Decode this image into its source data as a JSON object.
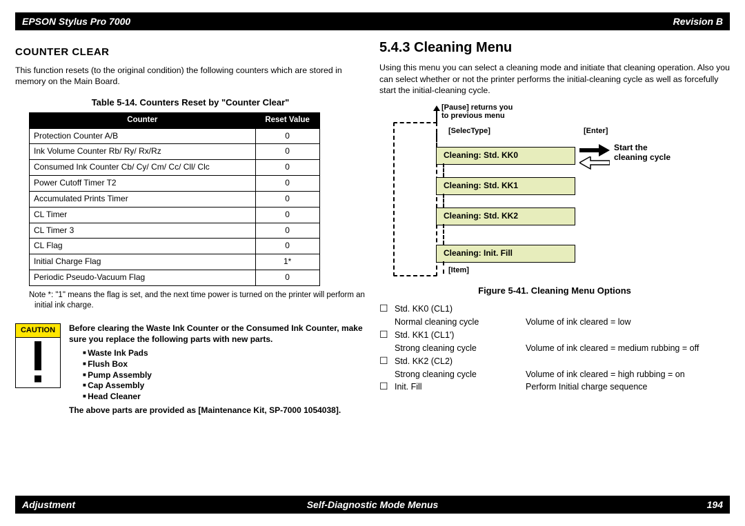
{
  "header": {
    "left": "EPSON Stylus Pro 7000",
    "right": "Revision B"
  },
  "footer": {
    "left": "Adjustment",
    "center": "Self-Diagnostic Mode Menus",
    "right": "194"
  },
  "left": {
    "title": "COUNTER CLEAR",
    "intro": "This function resets (to the original condition) the following counters which are stored in memory on the Main Board.",
    "table_caption": "Table 5-14.  Counters Reset by \"Counter Clear\"",
    "th_counter": "Counter",
    "th_reset": "Reset Value",
    "rows": [
      {
        "c": "Protection Counter A/B",
        "v": "0"
      },
      {
        "c": "Ink Volume Counter Rb/ Ry/ Rx/Rz",
        "v": "0"
      },
      {
        "c": "Consumed Ink Counter Cb/ Cy/ Cm/ Cc/ Cll/ Clc",
        "v": "0"
      },
      {
        "c": "Power Cutoff Timer T2",
        "v": "0"
      },
      {
        "c": "Accumulated Prints Timer",
        "v": "0"
      },
      {
        "c": "CL Timer",
        "v": "0"
      },
      {
        "c": "CL Timer 3",
        "v": "0"
      },
      {
        "c": "CL Flag",
        "v": "0"
      },
      {
        "c": "Initial Charge Flag",
        "v": "1*"
      },
      {
        "c": "Periodic Pseudo-Vacuum Flag",
        "v": "0"
      }
    ],
    "note": "Note *: \"1\" means the flag is set, and the next time power is turned on the printer will perform an initial ink charge.",
    "caution_label": "CAUTION",
    "caution_lead_bold": "Before clearing the Waste Ink Counter or the Consumed Ink Counter, make sure you replace the following parts with new parts.",
    "caution_items": [
      "Waste Ink Pads",
      "Flush Box",
      "Pump Assembly",
      "Cap Assembly",
      "Head Cleaner"
    ],
    "caution_tail": "The above parts are provided as [Maintenance Kit, SP-7000 1054038]."
  },
  "right": {
    "heading": "5.4.3  Cleaning Menu",
    "intro": "Using this menu you can select a cleaning mode and initiate that cleaning operation. Also you can select whether or not the printer performs the initial-cleaning cycle as well as forcefully start the initial-cleaning cycle.",
    "pause_hint_l1": "[Pause] returns you",
    "pause_hint_l2": "to previous menu",
    "label_selectype": "[SelecType]",
    "label_enter": "[Enter]",
    "label_item": "[Item]",
    "start_l1": "Start the",
    "start_l2": "cleaning cycle",
    "menu_items": [
      "Cleaning: Std.    KK0",
      "Cleaning: Std.    KK1",
      "Cleaning: Std.    KK2",
      "Cleaning: Init. Fill"
    ],
    "fig_caption": "Figure 5-41.  Cleaning Menu Options",
    "options": [
      {
        "t": "Std. KK0 (CL1)",
        "d": "Normal cleaning cycle",
        "r": "Volume of ink cleared = low"
      },
      {
        "t": "Std. KK1 (CL1')",
        "d": "Strong cleaning cycle",
        "r": "Volume of ink cleared = medium rubbing = off"
      },
      {
        "t": "Std. KK2 (CL2)",
        "d": "Strong cleaning cycle",
        "r": "Volume of ink cleared = high rubbing = on"
      },
      {
        "t": "Init. Fill",
        "d": "",
        "r": "Perform Initial charge sequence"
      }
    ]
  }
}
